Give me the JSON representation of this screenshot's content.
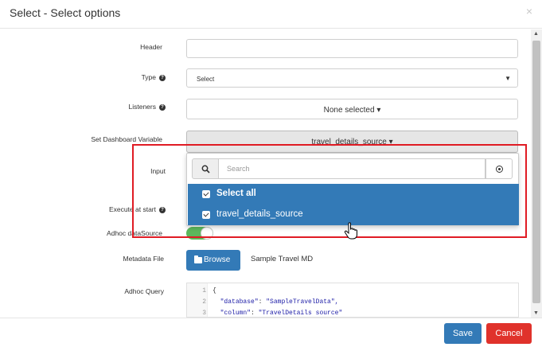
{
  "modal": {
    "title": "Select - Select options",
    "close": "×"
  },
  "form": {
    "header_label": "Header",
    "type_label": "Type",
    "type_value": "Select",
    "listeners_label": "Listeners",
    "listeners_value": "None selected",
    "dashboard_var_label": "Set Dashboard Variable",
    "dashboard_var_value": "travel_details_source",
    "input_label": "Input",
    "execute_label": "Execute at start",
    "adhoc_ds_label": "Adhoc dataSource",
    "adhoc_ds_on": true,
    "metadata_label": "Metadata File",
    "browse_label": "Browse",
    "metadata_file": "Sample Travel MD",
    "adhoc_query_label": "Adhoc Query"
  },
  "dropdown": {
    "search_placeholder": "Search",
    "options": [
      {
        "label": "Select all",
        "checked": true,
        "bold": true
      },
      {
        "label": "travel_details_source",
        "checked": true,
        "bold": false
      }
    ]
  },
  "code": {
    "lines": [
      {
        "n": "1",
        "text": "{"
      },
      {
        "n": "2",
        "key": "\"database\"",
        "val": "\"SampleTravelData\","
      },
      {
        "n": "3",
        "key": "\"column\"",
        "val": "\"TravelDetails source\""
      }
    ]
  },
  "footer": {
    "save": "Save",
    "cancel": "Cancel"
  },
  "colors": {
    "primary": "#337ab7",
    "danger": "#e0322b",
    "highlight": "#e01b24",
    "toggle_on": "#5cb85c"
  }
}
